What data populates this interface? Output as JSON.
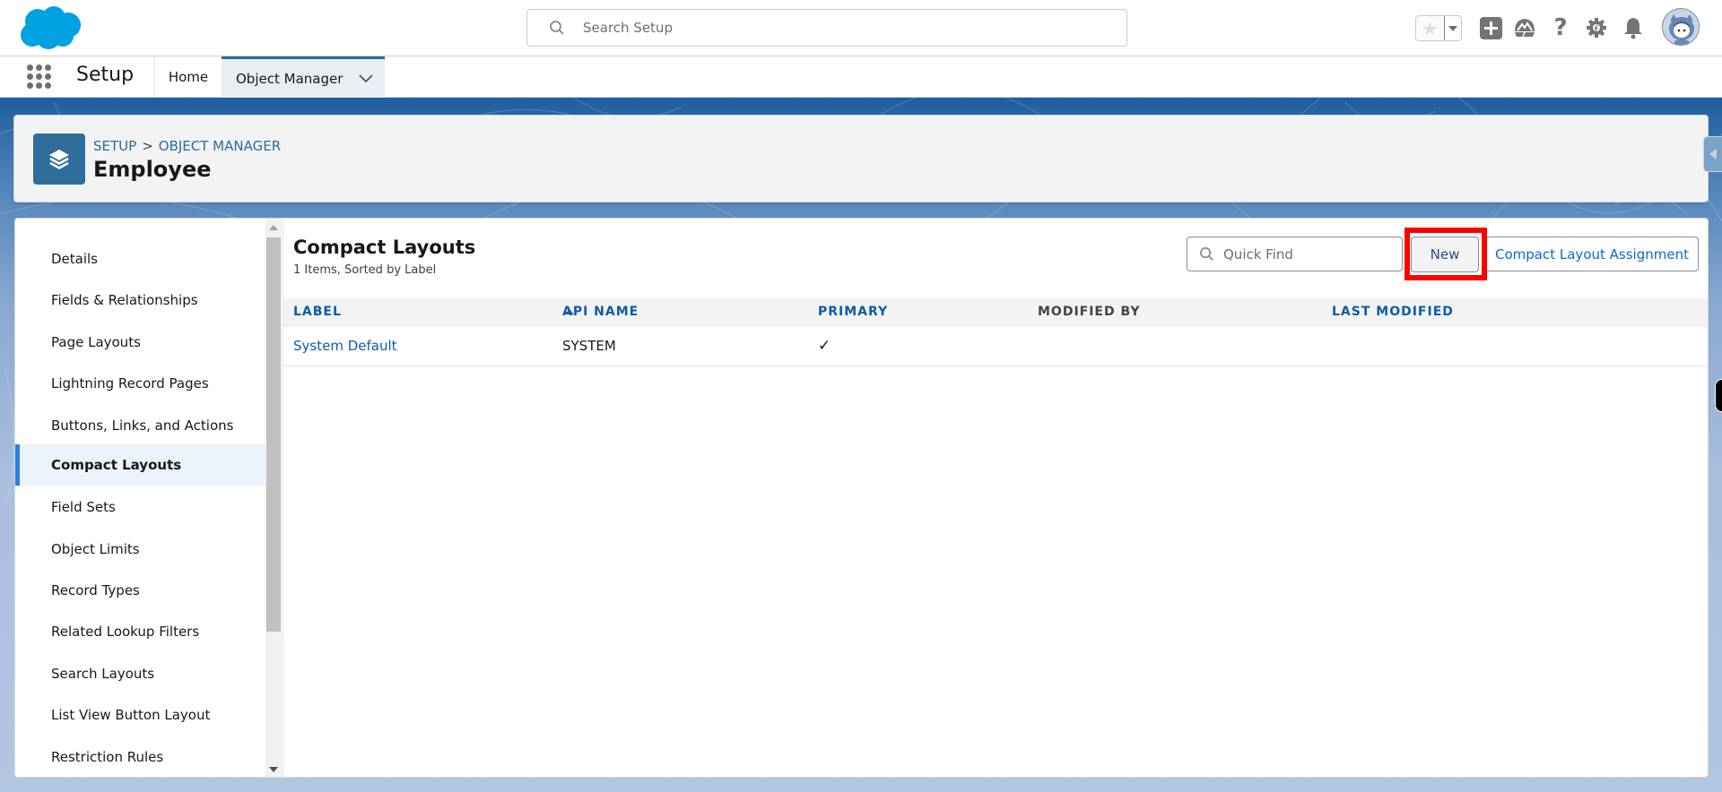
{
  "header": {
    "logo": "salesforce-cloud-logo",
    "search_placeholder": "Search Setup",
    "icons": [
      "favorites-star-icon",
      "favorites-dropdown-icon",
      "global-create-icon",
      "trailhead-icon",
      "help-icon",
      "setup-gear-icon",
      "notifications-bell-icon",
      "user-avatar"
    ]
  },
  "nav": {
    "app_name": "Setup",
    "tabs": [
      {
        "label": "Home"
      },
      {
        "label": "Object Manager",
        "active": true
      }
    ]
  },
  "page_header": {
    "breadcrumb": [
      "SETUP",
      "OBJECT MANAGER"
    ],
    "breadcrumb_separator": ">",
    "title": "Employee",
    "icon": "stack-layers-icon"
  },
  "sidebar": {
    "items": [
      {
        "label": "Details"
      },
      {
        "label": "Fields & Relationships"
      },
      {
        "label": "Page Layouts"
      },
      {
        "label": "Lightning Record Pages"
      },
      {
        "label": "Buttons, Links, and Actions"
      },
      {
        "label": "Compact Layouts",
        "active": true
      },
      {
        "label": "Field Sets"
      },
      {
        "label": "Object Limits"
      },
      {
        "label": "Record Types"
      },
      {
        "label": "Related Lookup Filters"
      },
      {
        "label": "Search Layouts"
      },
      {
        "label": "List View Button Layout"
      },
      {
        "label": "Restriction Rules"
      }
    ]
  },
  "content": {
    "title": "Compact Layouts",
    "subtitle": "1 Items, Sorted by Label",
    "quick_find_placeholder": "Quick Find",
    "new_button": "New",
    "assignment_button": "Compact Layout Assignment",
    "table": {
      "columns": [
        "LABEL",
        "API NAME",
        "PRIMARY",
        "MODIFIED BY",
        "LAST MODIFIED"
      ],
      "sorted_column": "LABEL",
      "sort_direction": "ascending",
      "rows": [
        {
          "label": "System Default",
          "api_name": "SYSTEM",
          "primary": "✓",
          "modified_by": "",
          "last_modified": ""
        }
      ]
    }
  },
  "colors": {
    "brand": "#00a1e0",
    "link": "#0b5cab",
    "active_tab_border": "#2a6c99",
    "highlight": "#ff0000",
    "sidebar_active_bar": "#2d7de0"
  }
}
